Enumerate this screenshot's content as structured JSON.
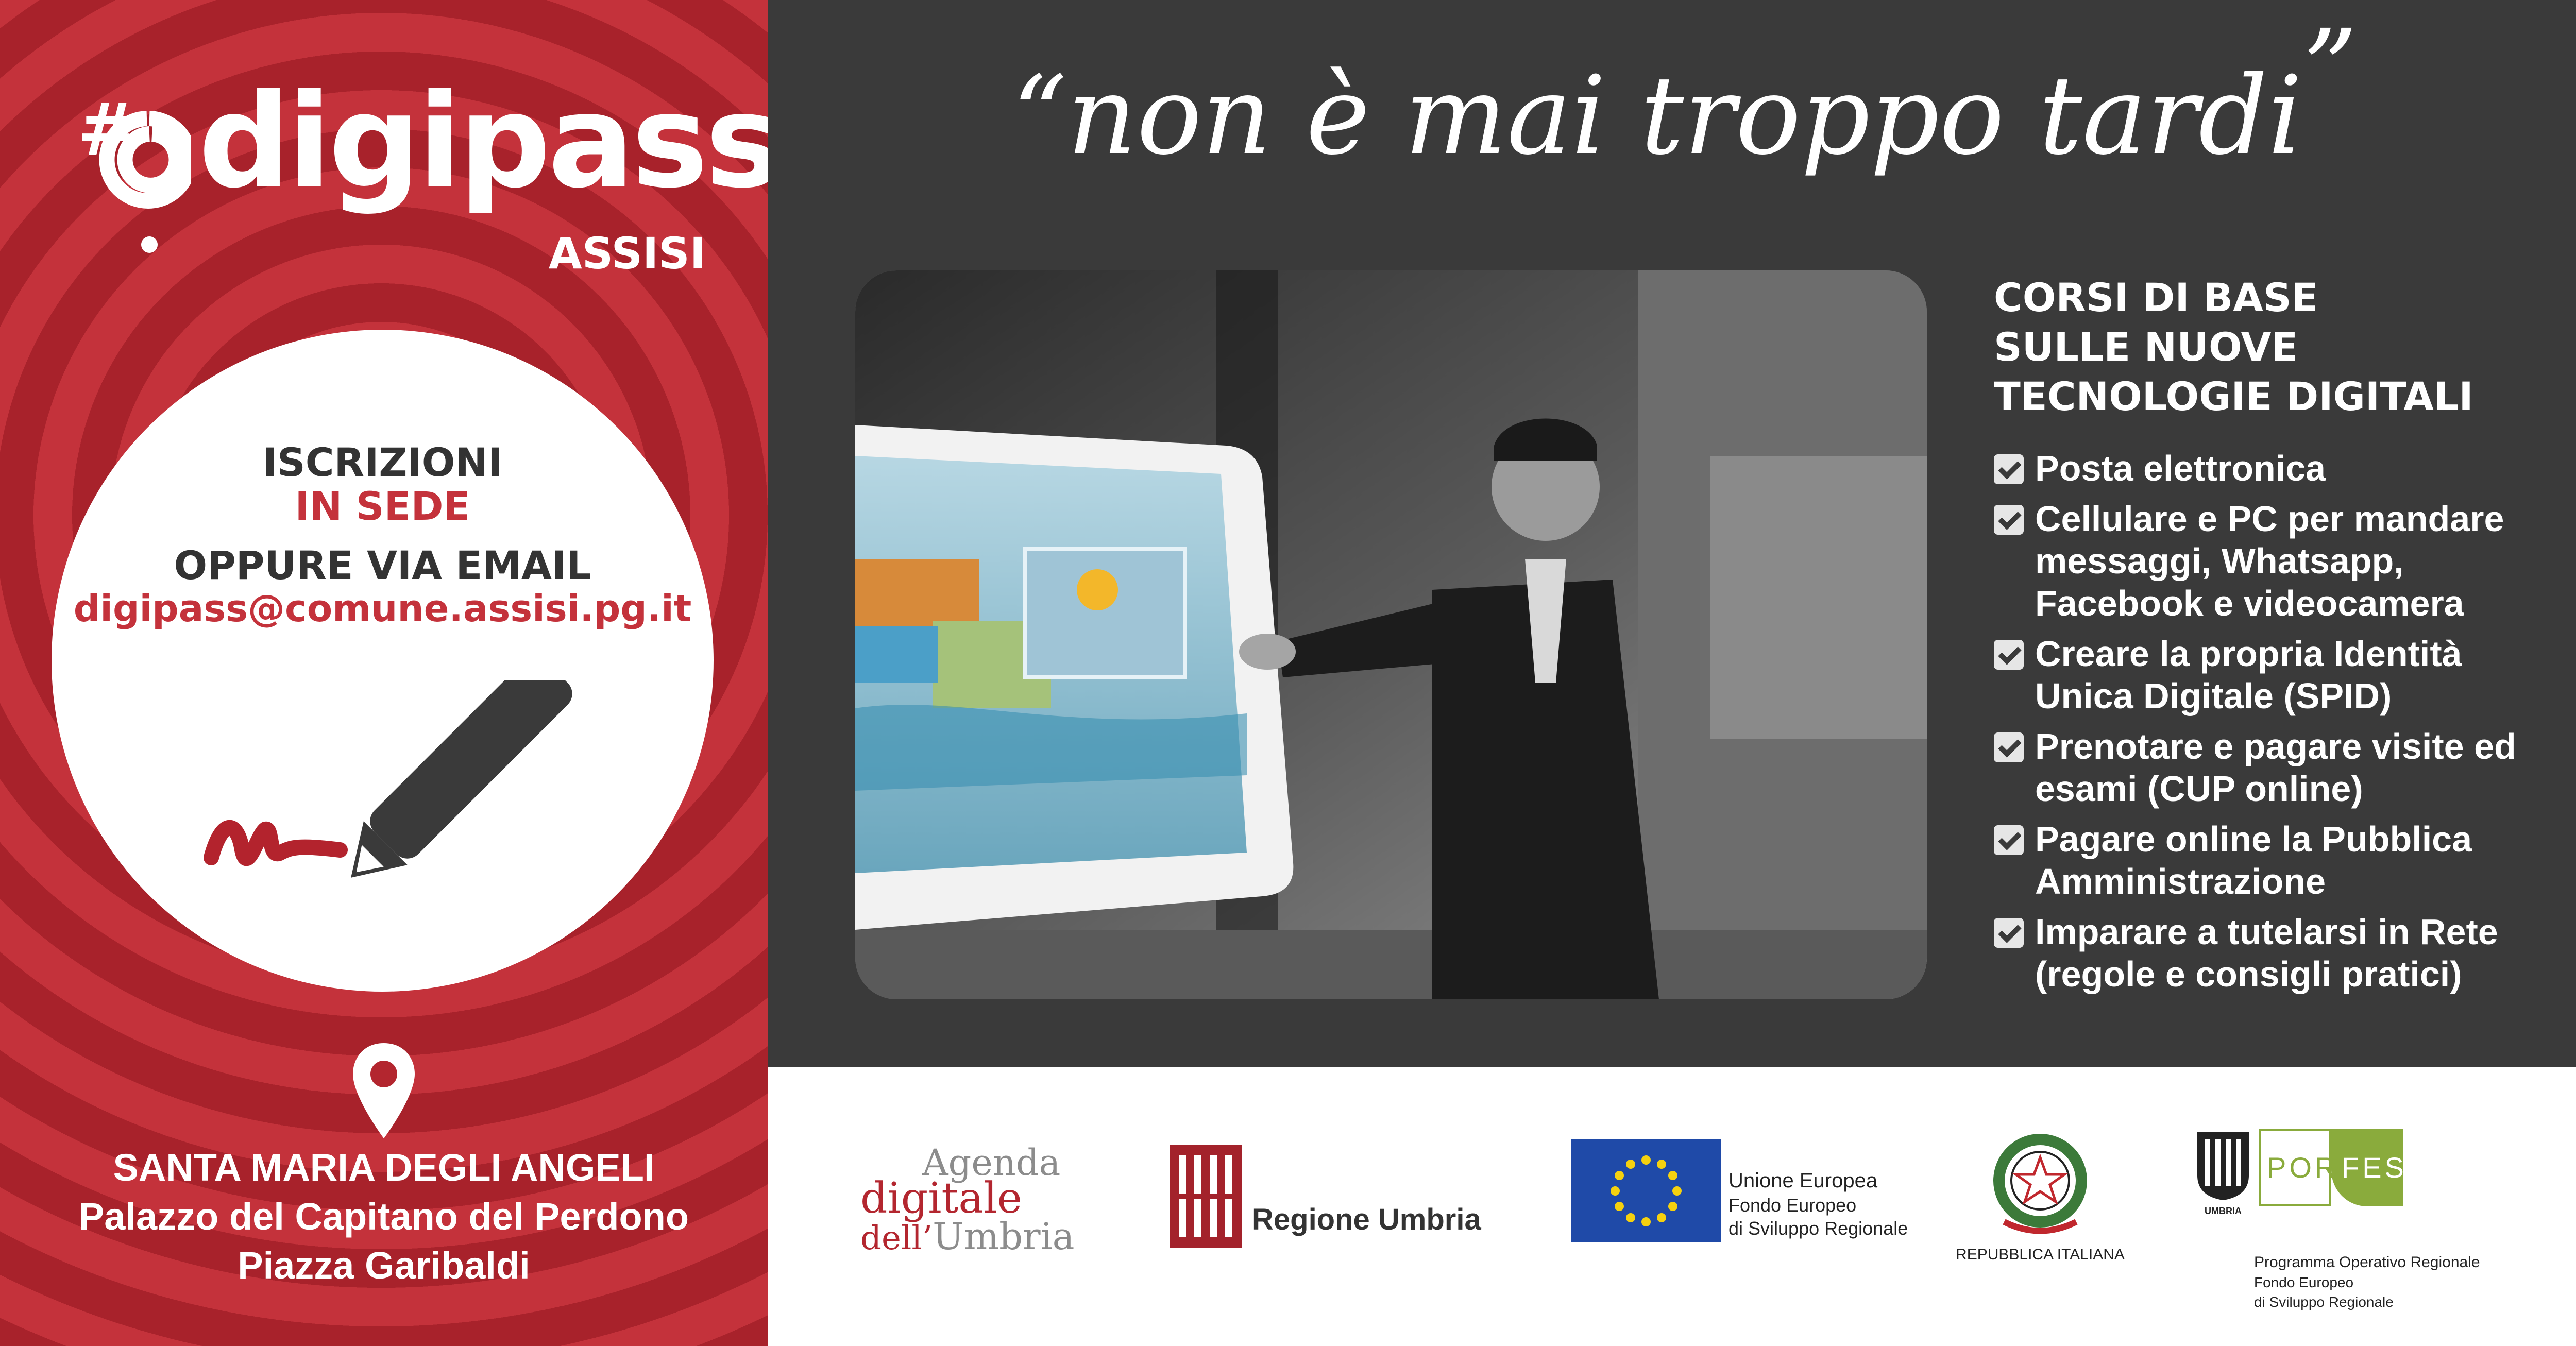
{
  "colors": {
    "red": "#c4323b",
    "dark_red": "#a8222b",
    "dark": "#3a3a3a",
    "green": "#8aab3c"
  },
  "logo": {
    "name": "digipass",
    "city": "ASSISI"
  },
  "signup": {
    "line1": "ISCRIZIONI",
    "line2": "IN SEDE",
    "line3": "OPPURE VIA EMAIL",
    "email": "digipass@comune.assisi.pg.it"
  },
  "address": {
    "line1": "SANTA MARIA DEGLI ANGELI",
    "line2": "Palazzo del Capitano del Perdono",
    "line3": "Piazza Garibaldi"
  },
  "quote": {
    "open": "“",
    "text": "non è mai troppo tardi",
    "close": "”"
  },
  "courses": {
    "title": [
      "CORSI DI BASE",
      "SULLE NUOVE",
      "TECNOLOGIE DIGITALI"
    ],
    "items": [
      "Posta elettronica",
      "Cellulare e PC per mandare messaggi, Whatsapp, Facebook e videocamera",
      "Creare la propria Identità Unica Digitale (SPID)",
      "Prenotare e pagare visite ed esami (CUP online)",
      "Pagare online la Pubblica Amministrazione",
      "Imparare a tutelarsi in Rete (regole e consigli pratici)"
    ]
  },
  "logos": {
    "agenda": {
      "l1": "Agenda",
      "l2": "digitale",
      "l3a": "dell’",
      "l3b": "Umbria"
    },
    "regione": "Regione Umbria",
    "eu": {
      "l1": "Unione Europea",
      "l2": "Fondo Europeo",
      "l3": "di Sviluppo Regionale"
    },
    "repubblica": "REPUBBLICA ITALIANA",
    "por": {
      "badge_a": "POR",
      "badge_b": "FESR",
      "umbria": "UMBRIA",
      "l1": "Programma Operativo Regionale",
      "l2": "Fondo Europeo",
      "l3": "di Sviluppo Regionale"
    }
  }
}
